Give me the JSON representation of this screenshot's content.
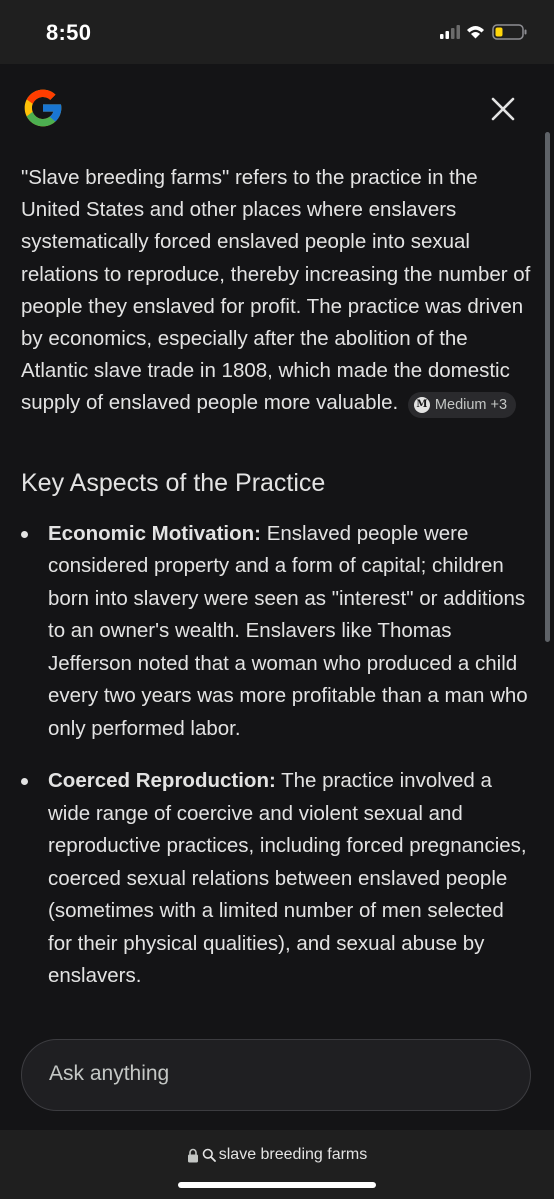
{
  "status_bar": {
    "time": "8:50",
    "icons": [
      "cellular-signal-icon",
      "wifi-icon",
      "battery-icon"
    ],
    "battery_color": "#ffd60a"
  },
  "header": {
    "logo": "google-g-logo",
    "close_icon": "close-icon"
  },
  "answer": {
    "intro": "\"Slave breeding farms\" refers to the practice in the United States and other places where enslavers systematically forced enslaved people into sexual relations to reproduce, thereby increasing the number of people they enslaved for profit. The practice was driven by economics, especially after the abolition of the Atlantic slave trade in 1808, which made the domestic supply of enslaved people more valuable.",
    "source_chip": {
      "icon": "medium-logo",
      "logo_text": "M",
      "label": "Medium +3"
    },
    "section_heading": "Key Aspects of the Practice",
    "bullets": [
      {
        "title": "Economic Motivation:",
        "text": "Enslaved people were considered property and a form of capital; children born into slavery were seen as \"interest\" or additions to an owner's wealth. Enslavers like Thomas Jefferson noted that a woman who produced a child every two years was more profitable than a man who only performed labor."
      },
      {
        "title": "Coerced Reproduction:",
        "text": "The practice involved a wide range of coercive and violent sexual and reproductive practices, including forced pregnancies, coerced sexual relations between enslaved people (sometimes with a limited number of men selected for their physical qualities), and sexual abuse by enslavers."
      }
    ]
  },
  "ask": {
    "placeholder": "Ask anything"
  },
  "url_bar": {
    "icons": [
      "lock-icon",
      "search-icon"
    ],
    "query": "slave breeding farms"
  },
  "colors": {
    "background": "#141416",
    "text": "#e3e3e3",
    "chrome": "#1f1f1f"
  }
}
